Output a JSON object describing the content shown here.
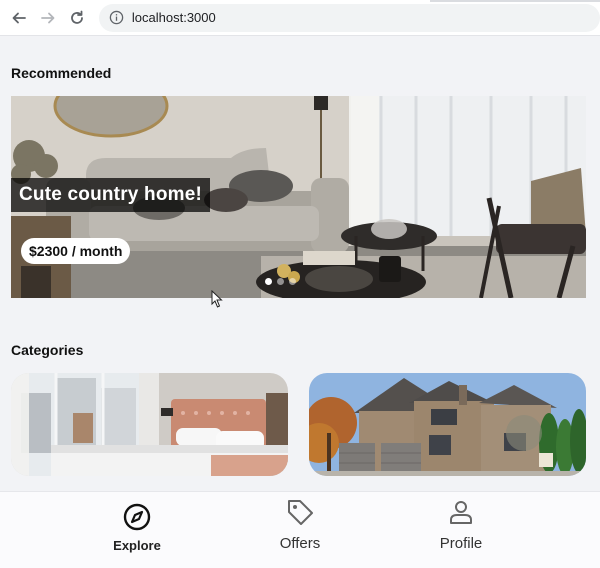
{
  "browser": {
    "url": "localhost:3000"
  },
  "recommended": {
    "title": "Recommended",
    "card": {
      "name": "Cute country home!",
      "price": "$2300 / month",
      "slide_count": 3,
      "active_slide": 1
    }
  },
  "categories": {
    "title": "Categories",
    "items": [
      {
        "icon": "bedroom-photo"
      },
      {
        "icon": "house-photo"
      }
    ]
  },
  "bottom_nav": {
    "items": [
      {
        "label": "Explore",
        "icon": "compass-icon",
        "active": true
      },
      {
        "label": "Offers",
        "icon": "tag-icon",
        "active": false
      },
      {
        "label": "Profile",
        "icon": "person-icon",
        "active": false
      }
    ]
  },
  "colors": {
    "page_bg": "#f2f3f6",
    "caption_bg": "#000000",
    "nav_bg": "#fbfbfd"
  }
}
